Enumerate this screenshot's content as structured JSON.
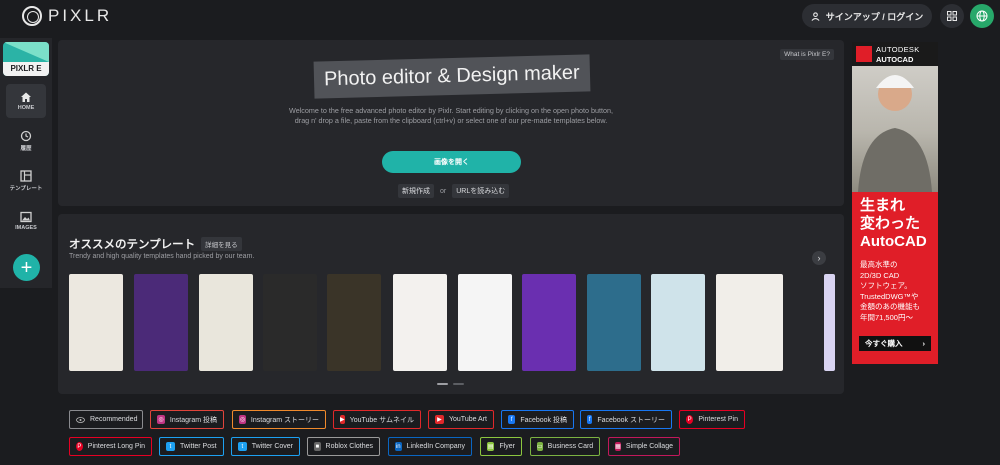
{
  "app": {
    "logo_text": "PIXLR"
  },
  "header": {
    "signup_label": "サインアップ / ログイン"
  },
  "sidebar": {
    "editor_badge": "PIXLR E",
    "items": [
      {
        "label": "HOME",
        "icon": "home-icon"
      },
      {
        "label": "履歴",
        "icon": "history-icon"
      },
      {
        "label": "テンプレート",
        "icon": "template-icon"
      },
      {
        "label": "IMAGES",
        "icon": "image-icon"
      }
    ],
    "add_label": "+"
  },
  "hero": {
    "whatis": "What is Pixlr E?",
    "title": "Photo editor & Design maker",
    "description": "Welcome to the free advanced photo editor by Pixlr. Start editing by clicking on the open photo button, drag n' drop a file, paste from the clipboard (ctrl+v) or select one of our pre-made templates below.",
    "open_button": "画像を開く",
    "new_link": "新規作成",
    "or_text": "or",
    "url_link": "URLを読み込む"
  },
  "templates": {
    "title": "オススメのテンプレート",
    "more_label": "詳細を見る",
    "subtitle": "Trendy and high quality templates hand picked by our team.",
    "next_label": "›",
    "thumbs": [
      {
        "bg": "#ece8e0"
      },
      {
        "bg": "#4b2a78"
      },
      {
        "bg": "#e9e6dc"
      },
      {
        "bg": "#2a2a2a"
      },
      {
        "bg": "#3a3428"
      },
      {
        "bg": "#f3f1ee"
      },
      {
        "bg": "#f5f5f5"
      },
      {
        "bg": "#6a2fb0"
      },
      {
        "bg": "#2d6d8c"
      },
      {
        "bg": "#cfe3ea"
      },
      {
        "bg": "#f1eee9"
      },
      {
        "bg": "#d9d4f2"
      }
    ]
  },
  "tags": [
    {
      "label": "Recommended",
      "icon": "eye-icon",
      "color": "#8a8b8f"
    },
    {
      "label": "Instagram 投稿",
      "icon": "instagram-icon",
      "color": "#e0443b"
    },
    {
      "label": "Instagram ストーリー",
      "icon": "instagram-icon",
      "color": "#f08a2c"
    },
    {
      "label": "YouTube サムネイル",
      "icon": "youtube-icon",
      "color": "#e0282a"
    },
    {
      "label": "YouTube Art",
      "icon": "youtube-icon",
      "color": "#e0282a"
    },
    {
      "label": "Facebook 投稿",
      "icon": "facebook-icon",
      "color": "#1877f2"
    },
    {
      "label": "Facebook ストーリー",
      "icon": "facebook-icon",
      "color": "#1877f2"
    },
    {
      "label": "Pinterest Pin",
      "icon": "pinterest-icon",
      "color": "#e60023"
    },
    {
      "label": "Pinterest Long Pin",
      "icon": "pinterest-icon",
      "color": "#e60023"
    },
    {
      "label": "Twitter Post",
      "icon": "twitter-icon",
      "color": "#1da1f2"
    },
    {
      "label": "Twitter Cover",
      "icon": "twitter-icon",
      "color": "#1da1f2"
    },
    {
      "label": "Roblox Clothes",
      "icon": "roblox-icon",
      "color": "#9a9a9a"
    },
    {
      "label": "LinkedIn Company",
      "icon": "linkedin-icon",
      "color": "#0a66c2"
    },
    {
      "label": "Flyer",
      "icon": "flyer-icon",
      "color": "#8cc63f"
    },
    {
      "label": "Business Card",
      "icon": "business-card-icon",
      "color": "#7cb342"
    },
    {
      "label": "Simple Collage",
      "icon": "collage-icon",
      "color": "#c2185b"
    }
  ],
  "ad": {
    "brand_line1": "AUTODESK",
    "brand_line2": "AUTOCAD",
    "headline1": "生まれ",
    "headline2": "変わった",
    "headline3": "AutoCAD",
    "body1": "最高水準の",
    "body2": "2D/3D CAD",
    "body3": "ソフトウェア。",
    "body4": "TrustedDWG™や",
    "body5": "金額のあの機能も",
    "body6": "年間71,500円～",
    "cta": "今すぐ購入"
  }
}
